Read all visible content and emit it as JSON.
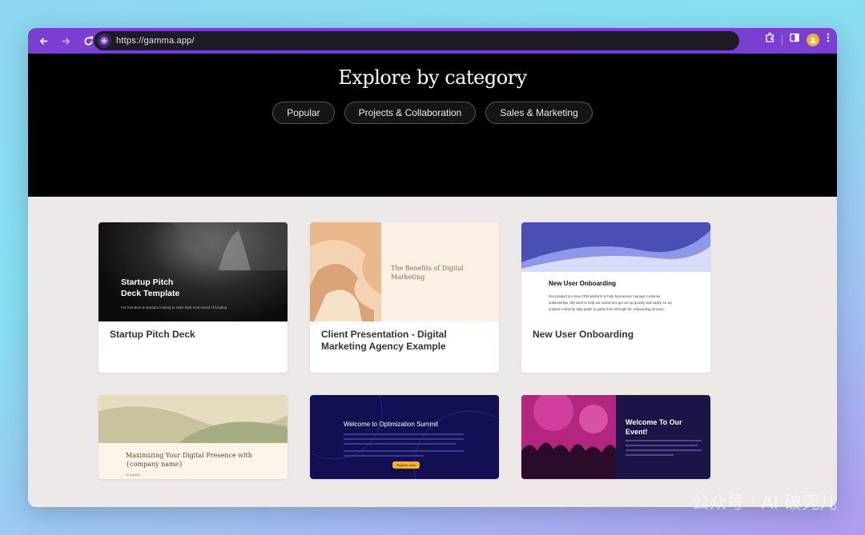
{
  "browser": {
    "url": "https://gamma.app/",
    "icons": [
      "back-arrow-icon",
      "forward-arrow-icon",
      "reload-icon",
      "gamma-site-icon",
      "extensions-icon",
      "side-panel-icon",
      "profile-avatar-icon",
      "menu-icon"
    ]
  },
  "hero": {
    "title": "Explore by category",
    "pills": [
      "Popular",
      "Projects & Collaboration",
      "Sales & Marketing"
    ]
  },
  "cards": [
    {
      "title": "Startup Pitch Deck",
      "thumb_title": "Startup Pitch Deck Template",
      "thumb_line1": "Startup Pitch",
      "thumb_line2": "Deck Template",
      "thumb_sub": "For founders & startups looking to raise their next round of funding"
    },
    {
      "title": "Client Presentation - Digital Marketing Agency Example",
      "title_line1": "Client Presentation - Digital",
      "title_line2": "Marketing Agency Example",
      "thumb_line1": "The Benefits of Digital",
      "thumb_line2": "Marketing"
    },
    {
      "title": "New User Onboarding",
      "thumb_title": "New User Onboarding",
      "thumb_p1": "Our product is a new CRM platform to help businesses manage customer",
      "thumb_p2": "relationships. We want to help our customers get set up quickly and easily, so we",
      "thumb_p3": "created a step-by-step guide to guide them through the onboarding process."
    },
    {
      "thumb_line1": "Maximizing Your Digital Presence with",
      "thumb_line2": "{company name}",
      "thumb_small": "Hi {name}"
    },
    {
      "thumb_title": "Welcome to Optimization Summit",
      "thumb_button": "Register Now"
    },
    {
      "thumb_line1": "Welcome To Our",
      "thumb_line2": "Event!"
    }
  ],
  "watermark": "公众号 · AI 破壳儿",
  "colors": {
    "toolbar": "#7a3fd0",
    "hero_bg": "#000000",
    "content_bg": "#ede9e8"
  }
}
